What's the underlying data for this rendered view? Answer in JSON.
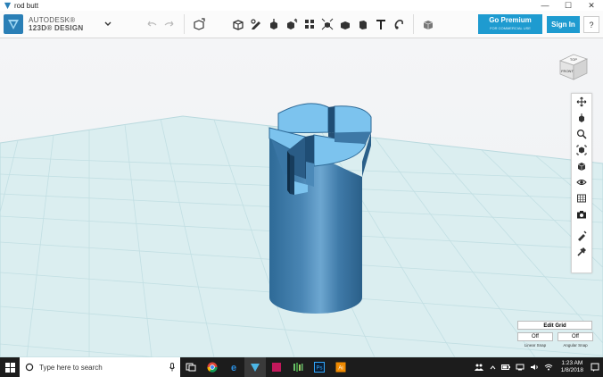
{
  "window": {
    "title": "rod butt",
    "min": "—",
    "max": "☐",
    "close": "✕"
  },
  "logo": {
    "line1": "AUTODESK®",
    "line2": "123D® DESIGN"
  },
  "premium": {
    "label": "Go Premium",
    "sub": "FOR COMMERCIAL USE"
  },
  "signin": "Sign In",
  "help": "?",
  "viewcube": {
    "top": "TOP",
    "front": "FRONT"
  },
  "grid_panel": {
    "title": "Edit Grid",
    "linear_value": "Off",
    "angular_value": "Off",
    "linear_label": "Linear Snap",
    "angular_label": "Angular Snap"
  },
  "taskbar": {
    "search_placeholder": "Type here to search",
    "time": "1:23 AM",
    "date": "1/8/2018",
    "app_ps": "Ps",
    "app_ai": "Ai"
  },
  "colors": {
    "accent": "#1e9bd0",
    "model": "#4a86b4",
    "model_top": "#7cc3ee",
    "grid": "#cfe6ea"
  }
}
